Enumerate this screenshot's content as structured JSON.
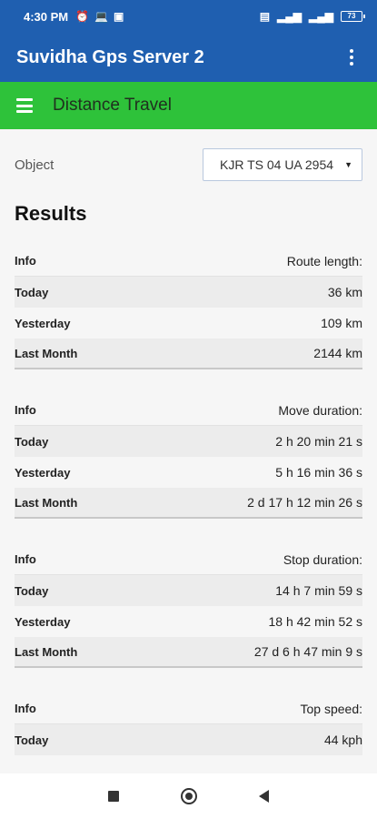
{
  "status_bar": {
    "time": "4:30 PM",
    "icons": [
      "alarm-icon",
      "laptop-icon",
      "message-icon"
    ],
    "right_icons": [
      "wifi-signal-icon",
      "cell-signal-icon",
      "cell-signal-icon-2"
    ],
    "battery": "73"
  },
  "app_bar": {
    "title": "Suvidha Gps Server 2"
  },
  "section_bar": {
    "title": "Distance Travel"
  },
  "object": {
    "label": "Object",
    "selected": "KJR TS 04 UA 2954"
  },
  "results_title": "Results",
  "blocks": [
    {
      "info_label": "Info",
      "info_value": "Route length:",
      "rows": [
        {
          "k": "Today",
          "v": "36 km"
        },
        {
          "k": "Yesterday",
          "v": "109 km"
        },
        {
          "k": "Last Month",
          "v": "2144 km"
        }
      ]
    },
    {
      "info_label": "Info",
      "info_value": "Move duration:",
      "rows": [
        {
          "k": "Today",
          "v": "2 h 20 min 21 s"
        },
        {
          "k": "Yesterday",
          "v": "5 h 16 min 36 s"
        },
        {
          "k": "Last Month",
          "v": "2 d 17 h 12 min 26 s"
        }
      ]
    },
    {
      "info_label": "Info",
      "info_value": "Stop duration:",
      "rows": [
        {
          "k": "Today",
          "v": "14 h 7 min 59 s"
        },
        {
          "k": "Yesterday",
          "v": "18 h 42 min 52 s"
        },
        {
          "k": "Last Month",
          "v": "27 d 6 h 47 min 9 s"
        }
      ]
    },
    {
      "info_label": "Info",
      "info_value": "Top speed:",
      "rows": [
        {
          "k": "Today",
          "v": "44 kph"
        }
      ]
    }
  ],
  "colors": {
    "primary": "#1f5fb0",
    "accent": "#2ec23a"
  }
}
